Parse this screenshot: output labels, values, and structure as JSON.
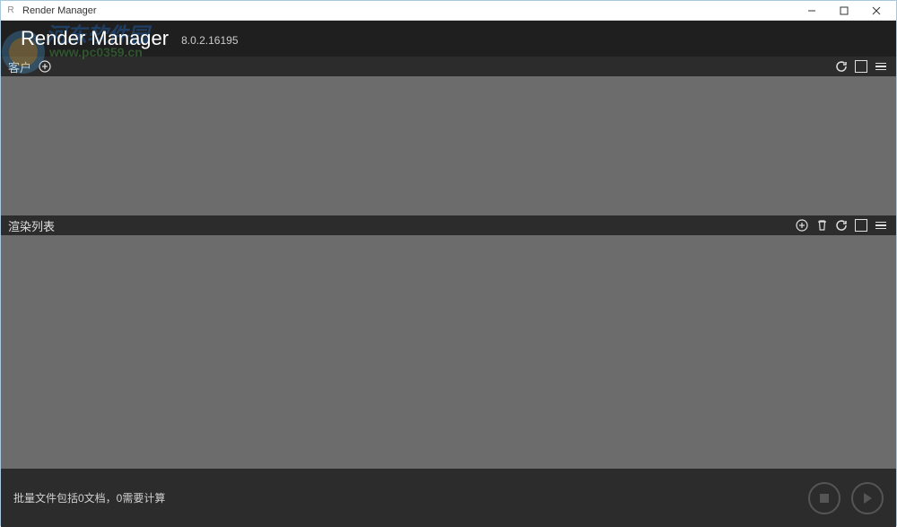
{
  "titlebar": {
    "title": "Render Manager"
  },
  "header": {
    "title": "Render Manager",
    "version": "8.0.2.16195"
  },
  "watermark": {
    "sitename": "河东软件园",
    "url": "www.pc0359.cn"
  },
  "sections": {
    "clients": {
      "label": "客户"
    },
    "queue": {
      "label": "渲染列表"
    }
  },
  "footer": {
    "status": "批量文件包括0文档，0需要计算"
  }
}
